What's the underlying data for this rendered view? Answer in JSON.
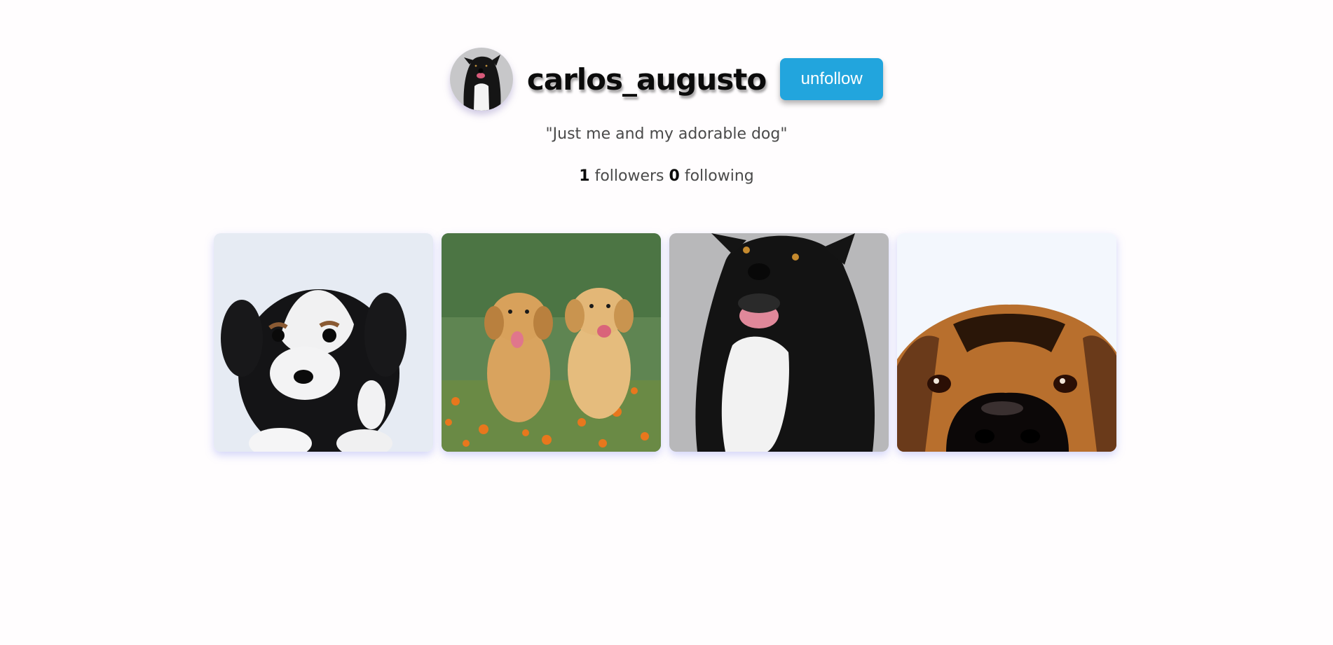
{
  "profile": {
    "username": "carlos_augusto",
    "follow_button_label": "unfollow",
    "bio": "\"Just me and my adorable dog\"",
    "followers_count": "1",
    "followers_label": "followers",
    "following_count": "0",
    "following_label": "following"
  },
  "posts": [
    {
      "subject": "black-and-white-puppy"
    },
    {
      "subject": "two-golden-retriever-puppies"
    },
    {
      "subject": "black-and-white-dog"
    },
    {
      "subject": "brown-dog-closeup"
    }
  ],
  "colors": {
    "button": "#22a5dd",
    "background": "#fffdfe"
  }
}
